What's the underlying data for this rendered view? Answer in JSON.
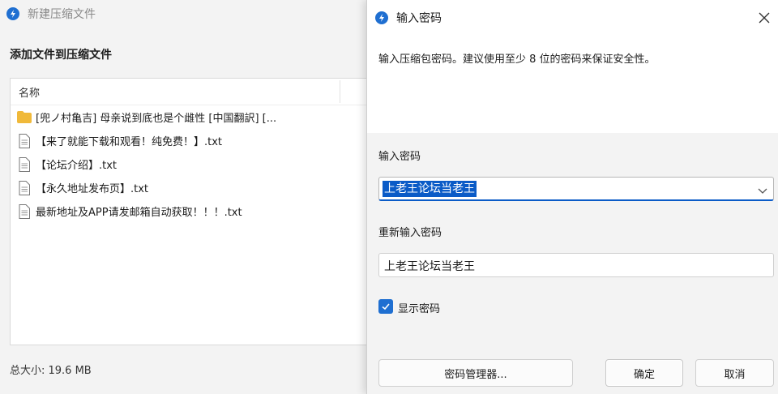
{
  "background_window": {
    "title": "新建压缩文件",
    "heading": "添加文件到压缩文件",
    "column_header": "名称",
    "files": [
      {
        "name": "[兜ノ村亀吉] 母亲说到底也是个雌性 [中国翻訳] [...",
        "type": "folder"
      },
      {
        "name": "【来了就能下载和观看！纯免费！】.txt",
        "type": "file"
      },
      {
        "name": "【论坛介绍】.txt",
        "type": "file"
      },
      {
        "name": "【永久地址发布页】.txt",
        "type": "file"
      },
      {
        "name": "最新地址及APP请发邮箱自动获取！！！.txt",
        "type": "file"
      }
    ],
    "total_size": "总大小: 19.6 MB"
  },
  "dialog": {
    "title": "输入密码",
    "description": "输入压缩包密码。建议使用至少 8 位的密码来保证安全性。",
    "password_label": "输入密码",
    "password_value": "上老王论坛当老王",
    "reenter_label": "重新输入密码",
    "reenter_value": "上老王论坛当老王",
    "show_password_label": "显示密码",
    "show_password_checked": true,
    "buttons": {
      "manager": "密码管理器...",
      "ok": "确定",
      "cancel": "取消"
    }
  },
  "colors": {
    "accent": "#0a5bc7",
    "folder": "#f0b93a"
  },
  "icons": {
    "app": "app-logo-icon",
    "close": "close-icon",
    "dropdown": "chevron-down-icon",
    "folder": "folder-icon",
    "file": "text-file-icon",
    "check": "checkmark-icon"
  }
}
